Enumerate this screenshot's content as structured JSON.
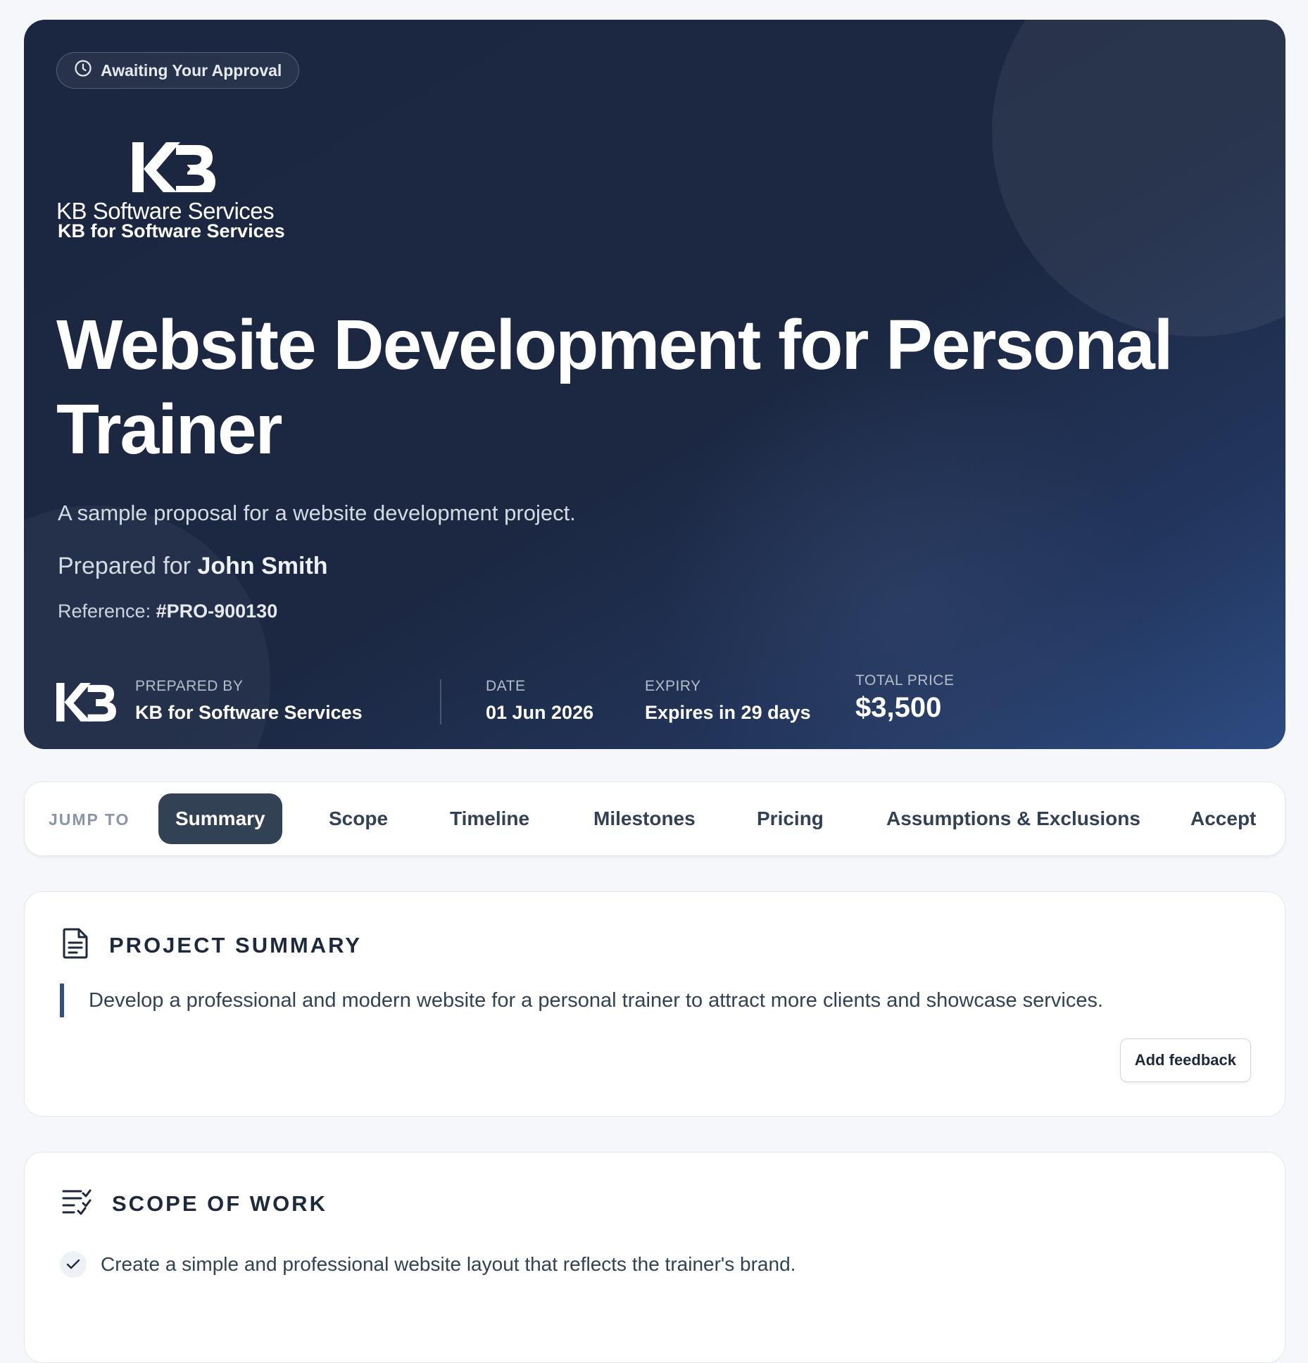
{
  "header": {
    "status": "Awaiting Your Approval",
    "logo_text": "KB Software Services",
    "company_name": "KB for Software Services",
    "title": "Website Development for Personal Trainer",
    "subtitle": "A sample proposal for a website development project.",
    "prepared_for_prefix": "Prepared for",
    "client_name": "John Smith",
    "reference_label": "Reference:",
    "reference_value": "#PRO-900130"
  },
  "meta": {
    "prepared_by_label": "PREPARED BY",
    "prepared_by_value": "KB for Software Services",
    "date_label": "DATE",
    "date_value": "01 Jun 2026",
    "expiry_label": "EXPIRY",
    "expiry_value": "Expires in 29 days",
    "total_label": "TOTAL PRICE",
    "total_value": "$3,500"
  },
  "jump_nav": {
    "label": "JUMP TO",
    "tabs": [
      "Summary",
      "Scope",
      "Timeline",
      "Milestones",
      "Pricing",
      "Assumptions & Exclusions",
      "Accept"
    ],
    "active": "Summary"
  },
  "summary": {
    "heading": "PROJECT SUMMARY",
    "text": "Develop a professional and modern website for a personal trainer to attract more clients and showcase services.",
    "feedback_button": "Add feedback"
  },
  "scope": {
    "heading": "SCOPE OF WORK",
    "items": [
      "Create a simple and professional website layout that reflects the trainer's brand."
    ]
  },
  "colors": {
    "hero_bg": "#1b2740",
    "accent": "#334155",
    "quote_bar": "#334f7e"
  }
}
